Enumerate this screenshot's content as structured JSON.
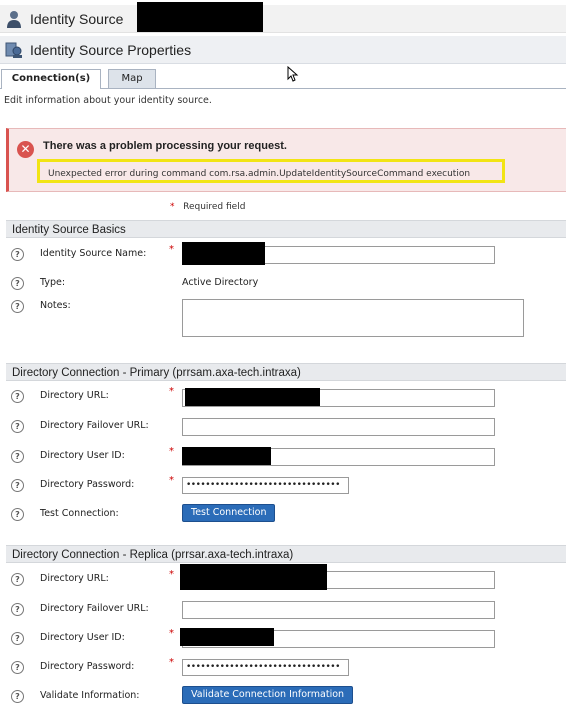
{
  "header": {
    "title": "Identity Source",
    "properties_title": "Identity Source Properties"
  },
  "tabs": [
    {
      "label": "Connection(s)",
      "active": true
    },
    {
      "label": "Map",
      "active": false
    }
  ],
  "intro": "Edit information about your identity source.",
  "error": {
    "title": "There was a problem processing your request.",
    "message": "Unexpected error during command com.rsa.admin.UpdateIdentitySourceCommand execution"
  },
  "required_note": "Required field",
  "basics": {
    "section_title": "Identity Source Basics",
    "name_label": "Identity Source Name:",
    "type_label": "Type:",
    "type_value": "Active Directory",
    "notes_label": "Notes:"
  },
  "primary": {
    "section_title": "Directory Connection - Primary (prrsam.axa-tech.intraxa)",
    "url_label": "Directory URL:",
    "failover_label": "Directory Failover URL:",
    "userid_label": "Directory User ID:",
    "password_label": "Directory Password:",
    "password_value": "••••••••••••••••••••••••••••••••",
    "test_label": "Test Connection:",
    "test_button": "Test Connection"
  },
  "replica": {
    "section_title": "Directory Connection - Replica (prrsar.axa-tech.intraxa)",
    "url_label": "Directory URL:",
    "failover_label": "Directory Failover URL:",
    "userid_label": "Directory User ID:",
    "password_label": "Directory Password:",
    "password_value": "••••••••••••••••••••••••••••••••",
    "validate_label": "Validate Information:",
    "validate_button": "Validate Connection Information"
  },
  "colors": {
    "accent_button": "#2b6cb8",
    "error_border": "#d9534f",
    "highlight": "#f2e414",
    "required_star": "#cc0000"
  }
}
